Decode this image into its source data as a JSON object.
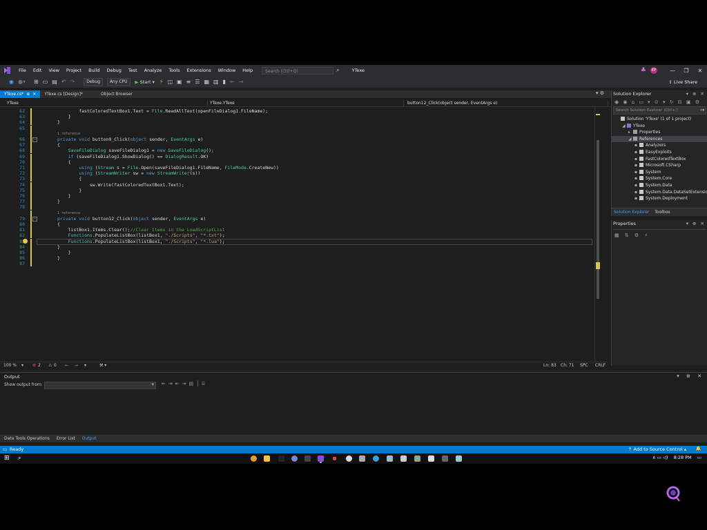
{
  "menubar": {
    "items": [
      "File",
      "Edit",
      "View",
      "Project",
      "Build",
      "Debug",
      "Test",
      "Analyze",
      "Tools",
      "Extensions",
      "Window",
      "Help"
    ],
    "search_placeholder": "Search (Ctrl+Q)",
    "solution_title": "YTexe",
    "user_initials": "EP"
  },
  "toolbar": {
    "config": "Debug",
    "platform": "Any CPU",
    "start_label": "Start",
    "live_share": "Live Share"
  },
  "tabs": [
    {
      "label": "YTexe.cs*",
      "active": true
    },
    {
      "label": "YTexe.cs [Design]*",
      "active": false
    },
    {
      "label": "Object Browser",
      "active": false
    }
  ],
  "navbar": {
    "project": "YTexe",
    "class": "YTexe.YTexe",
    "member": "button12_Click(object sender, EventArgs e)"
  },
  "code_lines": [
    {
      "n": "62",
      "text": "        fastColoredTextBox1.Text = File.ReadAllText(openFileDialog1.FileName);"
    },
    {
      "n": "63",
      "text": "    }"
    },
    {
      "n": "64",
      "text": "}"
    },
    {
      "n": "65",
      "text": ""
    },
    {
      "n": "",
      "ref": "1 reference"
    },
    {
      "n": "66",
      "text": "private void button9_Click(object sender, EventArgs e)"
    },
    {
      "n": "67",
      "text": "{"
    },
    {
      "n": "68",
      "text": "    SaveFileDialog saveFileDialog1 = new SaveFileDialog();"
    },
    {
      "n": "69",
      "text": "    if (saveFileDialog1.ShowDialog() == DialogResult.OK)"
    },
    {
      "n": "70",
      "text": "    {"
    },
    {
      "n": "71",
      "text": "        using (Stream s = File.Open(saveFileDialog1.FileName, FileMode.CreateNew))"
    },
    {
      "n": "72",
      "text": "        using (StreamWriter sw = new StreamWriter(s))"
    },
    {
      "n": "73",
      "text": "        {"
    },
    {
      "n": "74",
      "text": "            sw.Write(fastColoredTextBox1.Text);"
    },
    {
      "n": "75",
      "text": "        }"
    },
    {
      "n": "76",
      "text": "    }"
    },
    {
      "n": "77",
      "text": "}"
    },
    {
      "n": "78",
      "text": ""
    },
    {
      "n": "",
      "ref": "1 reference"
    },
    {
      "n": "79",
      "text": "private void button12_Click(object sender, EventArgs e)"
    },
    {
      "n": "80",
      "text": "{"
    },
    {
      "n": "81",
      "text": "    listBox1.Items.Clear();//Clear Items in the LoadScriptList"
    },
    {
      "n": "82",
      "text": "    Functions.PopulateListBox(listBox1, \"./Scripts\", \"*.txt\");"
    },
    {
      "n": "83",
      "text": "    Functions.PopulateListBox(listBox1, \"./Scripts\", \"*.lua\");"
    },
    {
      "n": "84",
      "text": "}"
    },
    {
      "n": "85",
      "text": "    }"
    },
    {
      "n": "86",
      "text": "}"
    },
    {
      "n": "87",
      "text": ""
    }
  ],
  "editor_status": {
    "zoom": "100 %",
    "errors": "2",
    "warnings": "0",
    "position": "Ln: 83",
    "column": "Ch: 71",
    "spc": "SPC",
    "crlf": "CRLF"
  },
  "output": {
    "title": "Output",
    "show_from": "Show output from:"
  },
  "bottom_tabs": [
    "Data Tools Operations",
    "Error List",
    "Output"
  ],
  "statusbar": {
    "ready": "Ready",
    "source_control": "Add to Source Control"
  },
  "taskbar": {
    "time": "8:28 PM"
  },
  "solution_explorer": {
    "title": "Solution Explorer",
    "search_placeholder": "Search Solution Explorer (Ctrl+;)",
    "nodes": [
      {
        "label": "Solution 'YTexe' (1 of 1 project)",
        "indent": 0
      },
      {
        "label": "YTexe",
        "indent": 1
      },
      {
        "label": "Properties",
        "indent": 2
      },
      {
        "label": "References",
        "indent": 2,
        "selected": true
      },
      {
        "label": "Analyzers",
        "indent": 3
      },
      {
        "label": "EasyExploits",
        "indent": 3
      },
      {
        "label": "FastColoredTextBox",
        "indent": 3
      },
      {
        "label": "Microsoft.CSharp",
        "indent": 3
      },
      {
        "label": "System",
        "indent": 3
      },
      {
        "label": "System.Core",
        "indent": 3
      },
      {
        "label": "System.Data",
        "indent": 3
      },
      {
        "label": "System.Data.DataSetExtensions",
        "indent": 3
      },
      {
        "label": "System.Deployment",
        "indent": 3
      }
    ],
    "bottom_tabs": [
      "Solution Explorer",
      "Toolbox"
    ]
  },
  "properties": {
    "title": "Properties"
  },
  "colors": {
    "accent": "#007acc",
    "background": "#1e1e1e",
    "chrome": "#2d2d30"
  }
}
